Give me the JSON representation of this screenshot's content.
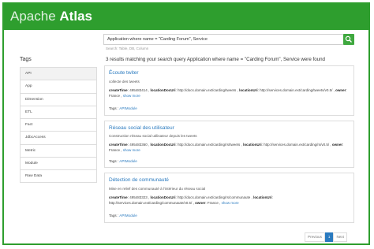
{
  "header": {
    "logo_light": "Apache",
    "logo_bold": "Atlas"
  },
  "search": {
    "value": "Application where name = \"Carding Forum\", Service",
    "hint": "Search: Table, DB, Column",
    "button_icon": "search-icon"
  },
  "sidebar": {
    "title": "Tags",
    "items": [
      {
        "label": "API"
      },
      {
        "label": "App"
      },
      {
        "label": "Dimension"
      },
      {
        "label": "ETL"
      },
      {
        "label": "Fact"
      },
      {
        "label": "JdbcAccess"
      },
      {
        "label": "Metric"
      },
      {
        "label": "Module"
      },
      {
        "label": "Raw Data"
      }
    ]
  },
  "results": {
    "title": "3 results matching your search query Application where name = \"Carding Forum\", Service were found",
    "cards": [
      {
        "title": "Écoute twiter",
        "desc": "collecte des tweets",
        "create_label": "createTime",
        "create_value": ": 495483414",
        "loc_doc_label": "locationDocUri",
        "loc_doc_value": ": http://docs.domain.ext/carding/tweets",
        "loc_uri_label": "locationUri",
        "loc_uri_value": ": http://services.domain.ext/carding/tweets/v0.5/",
        "owner_label": "owner",
        "owner_value": ": France",
        "show_more": "show more",
        "tags_label": "Tags :",
        "tag": "APIModule"
      },
      {
        "title": "Réseau social des utilisateur",
        "desc": "Construction réseau social utilisateur depuis les tweets",
        "create_label": "createTime",
        "create_value": ": 495483360",
        "loc_doc_label": "locationDocUri",
        "loc_doc_value": ": http://docs.domain.ext/carding/rs/tweets",
        "loc_uri_label": "locationUri",
        "loc_uri_value": ": http://services.domain.ext/carding/rs/v0.5/",
        "owner_label": "owner",
        "owner_value": ": France",
        "show_more": "show more",
        "tags_label": "Tags :",
        "tag": "APIModule"
      },
      {
        "title": "Détection de communauté",
        "desc": "Mise en relief des communauté à l'intérieur du réseau social",
        "create_label": "createTime",
        "create_value": ": 495483323",
        "loc_doc_label": "locationDocUri",
        "loc_doc_value": ": http://docs.domain.ext/carding/rs/communaute",
        "loc_uri_label": "locationUri",
        "loc_uri_value": ": http://services.domain.ext/carding/communaute/v0.5/",
        "owner_label": "owner",
        "owner_value": ": France",
        "show_more": "show more",
        "tags_label": "Tags :",
        "tag": "APIModule"
      }
    ]
  },
  "pagination": {
    "previous": "Previous",
    "current": "1",
    "next": "Next"
  },
  "colors": {
    "brand_green": "#2e9e2e",
    "link_blue": "#2a7abf"
  }
}
